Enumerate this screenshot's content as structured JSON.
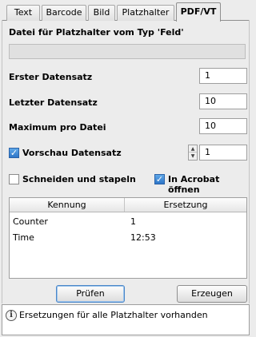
{
  "tabs": [
    {
      "label": "Text",
      "active": false
    },
    {
      "label": "Barcode",
      "active": false
    },
    {
      "label": "Bild",
      "active": false
    },
    {
      "label": "Platzhalter",
      "active": false
    },
    {
      "label": "PDF/VT",
      "active": true
    }
  ],
  "heading": "Datei für Platzhalter vom Typ 'Feld'",
  "file_value": "",
  "fields": {
    "first_record": {
      "label": "Erster Datensatz",
      "value": "1"
    },
    "last_record": {
      "label": "Letzter Datensatz",
      "value": "10"
    },
    "max_per_file": {
      "label": "Maximum pro Datei",
      "value": "10"
    }
  },
  "preview": {
    "label": "Vorschau Datensatz",
    "checked": true,
    "value": "1"
  },
  "cut_stack": {
    "label": "Schneiden und stapeln",
    "checked": false
  },
  "open_acrobat": {
    "label": "In Acrobat öffnen",
    "checked": true
  },
  "table": {
    "columns": [
      "Kennung",
      "Ersetzung"
    ],
    "rows": [
      [
        "Counter",
        "1"
      ],
      [
        "Time",
        "12:53"
      ]
    ]
  },
  "buttons": {
    "check": "Prüfen",
    "generate": "Erzeugen"
  },
  "status": {
    "icon": "info-icon",
    "text": "Ersetzungen für alle Platzhalter vorhanden"
  }
}
